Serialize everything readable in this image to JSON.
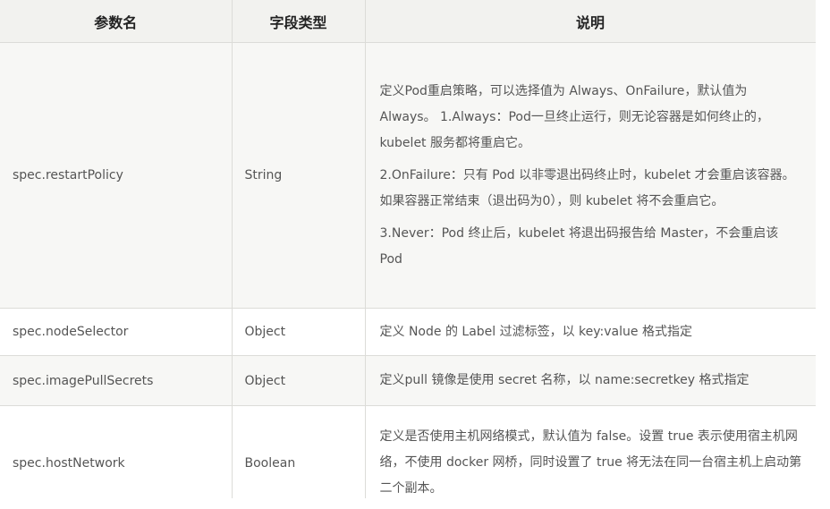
{
  "table": {
    "headers": [
      "参数名",
      "字段类型",
      "说明"
    ],
    "rows": [
      {
        "name": "spec.restartPolicy",
        "type": "String",
        "desc": [
          "定义Pod重启策略，可以选择值为 Always、OnFailure，默认值为 Always。 1.Always：Pod一旦终止运行，则无论容器是如何终止的，kubelet 服务都将重启它。",
          "2.OnFailure：只有 Pod 以非零退出码终止时，kubelet 才会重启该容器。如果容器正常结束（退出码为0），则 kubelet 将不会重启它。",
          "3.Never：Pod 终止后，kubelet 将退出码报告给 Master，不会重启该 Pod"
        ]
      },
      {
        "name": "spec.nodeSelector",
        "type": "Object",
        "desc": [
          "定义 Node 的 Label 过滤标签，以 key:value 格式指定"
        ]
      },
      {
        "name": "spec.imagePullSecrets",
        "type": "Object",
        "desc": [
          "定义pull 镜像是使用 secret 名称，以 name:secretkey 格式指定"
        ]
      },
      {
        "name": "spec.hostNetwork",
        "type": "Boolean",
        "desc": [
          "定义是否使用主机网络模式，默认值为 false。设置 true 表示使用宿主机网络，不使用 docker 网桥，同时设置了 true 将无法在同一台宿主机上启动第二个副本。"
        ]
      }
    ]
  }
}
